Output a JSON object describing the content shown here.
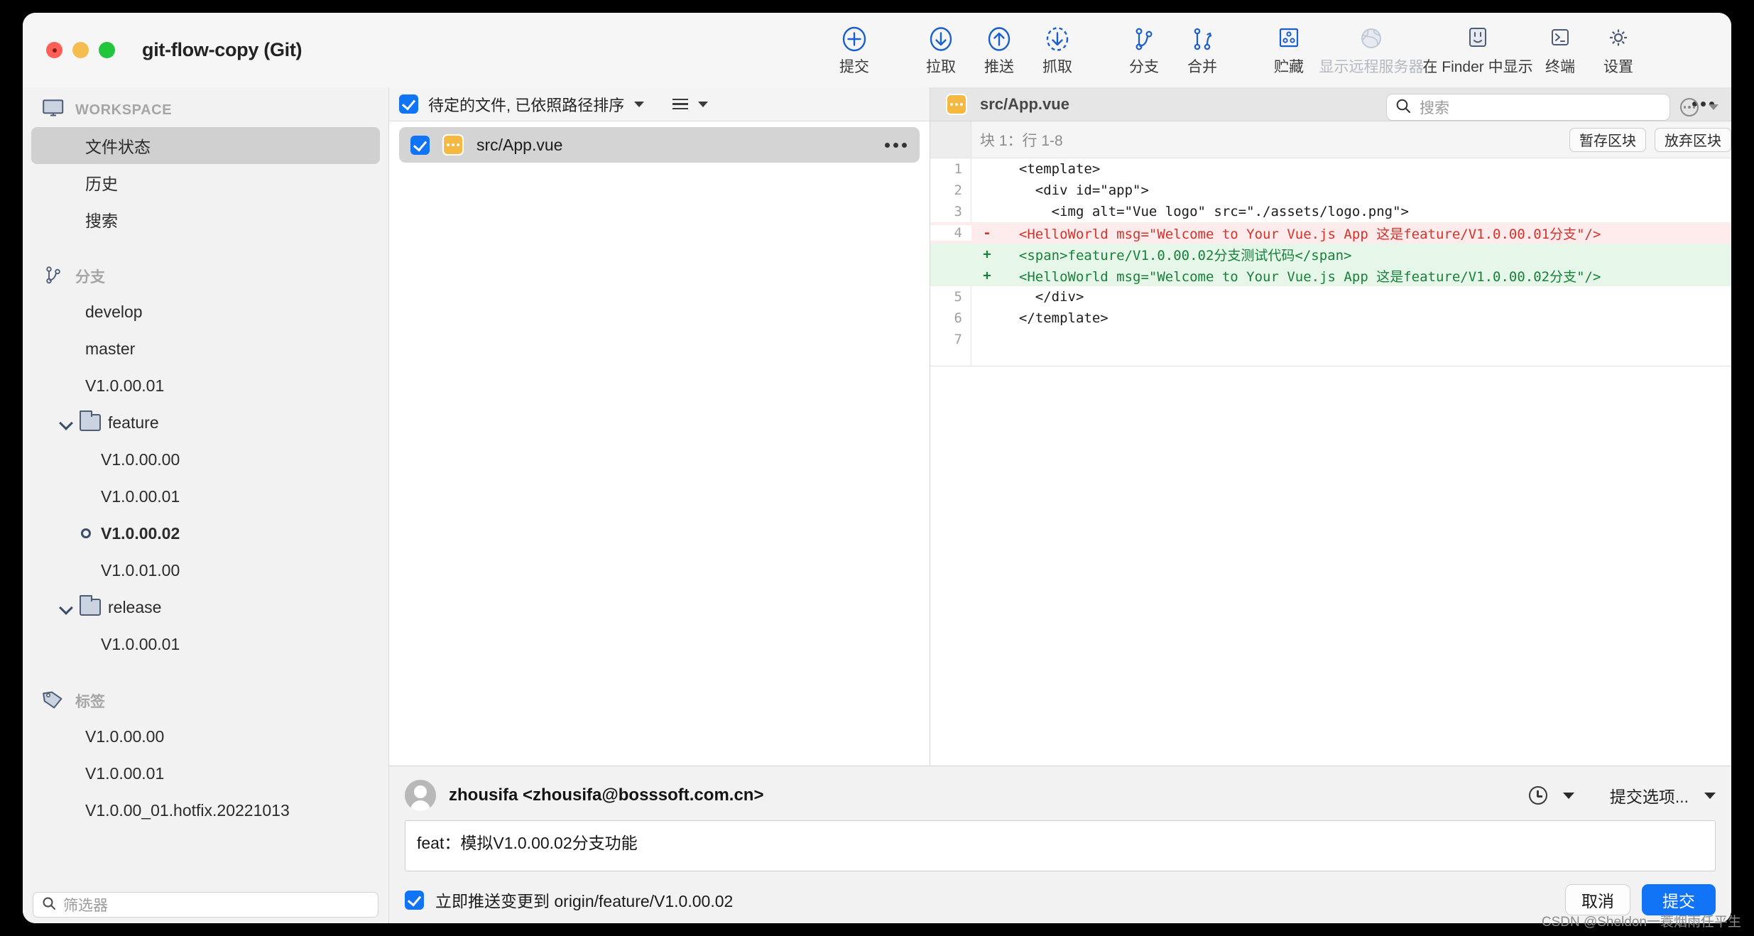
{
  "window": {
    "title": "git-flow-copy (Git)"
  },
  "toolbar": {
    "items": [
      {
        "label": "提交",
        "icon": "plus-circle-icon",
        "disabled": false
      },
      {
        "label": "拉取",
        "icon": "arrow-down-circle-icon",
        "disabled": false
      },
      {
        "label": "推送",
        "icon": "arrow-up-circle-icon",
        "disabled": false
      },
      {
        "label": "抓取",
        "icon": "arrow-down-dashed-circle-icon",
        "disabled": false
      },
      {
        "label": "分支",
        "icon": "branch-icon",
        "disabled": false
      },
      {
        "label": "合并",
        "icon": "merge-icon",
        "disabled": false
      },
      {
        "label": "贮藏",
        "icon": "stash-icon",
        "disabled": false
      },
      {
        "label": "显示远程服务器",
        "icon": "globe-icon",
        "disabled": true
      },
      {
        "label": "在 Finder 中显示",
        "icon": "finder-icon",
        "disabled": false
      },
      {
        "label": "终端",
        "icon": "terminal-icon",
        "disabled": false
      },
      {
        "label": "设置",
        "icon": "gear-icon",
        "disabled": false
      }
    ]
  },
  "sidebar": {
    "workspace": {
      "header": "WORKSPACE",
      "items": [
        {
          "label": "文件状态",
          "selected": true
        },
        {
          "label": "历史",
          "selected": false
        },
        {
          "label": "搜索",
          "selected": false
        }
      ]
    },
    "branches": {
      "header": "分支",
      "items": [
        {
          "label": "develop",
          "type": "branch",
          "indent": 0,
          "current": false
        },
        {
          "label": "master",
          "type": "branch",
          "indent": 0,
          "current": false
        },
        {
          "label": "V1.0.00.01",
          "type": "branch",
          "indent": 0,
          "current": false
        },
        {
          "label": "feature",
          "type": "folder",
          "indent": 0,
          "expanded": true
        },
        {
          "label": "V1.0.00.00",
          "type": "branch",
          "indent": 1,
          "current": false
        },
        {
          "label": "V1.0.00.01",
          "type": "branch",
          "indent": 1,
          "current": false
        },
        {
          "label": "V1.0.00.02",
          "type": "branch",
          "indent": 1,
          "current": true
        },
        {
          "label": "V1.0.01.00",
          "type": "branch",
          "indent": 1,
          "current": false
        },
        {
          "label": "release",
          "type": "folder",
          "indent": 0,
          "expanded": true
        },
        {
          "label": "V1.0.00.01",
          "type": "branch",
          "indent": 1,
          "current": false
        }
      ]
    },
    "tags": {
      "header": "标签",
      "items": [
        {
          "label": "V1.0.00.00"
        },
        {
          "label": "V1.0.00.01"
        },
        {
          "label": "V1.0.00_01.hotfix.20221013"
        }
      ]
    },
    "filter": {
      "placeholder": "筛选器",
      "value": ""
    }
  },
  "filelist": {
    "header_label": "待定的文件, 已依照路径排序",
    "header_checked": true,
    "rows": [
      {
        "name": "src/App.vue",
        "checked": true,
        "status": "modified",
        "selected": true
      }
    ]
  },
  "search": {
    "placeholder": "搜索",
    "value": ""
  },
  "diff": {
    "filename": "src/App.vue",
    "hunk_label": "块 1：行 1-8",
    "stage_hunk_label": "暂存区块",
    "discard_hunk_label": "放弃区块",
    "lines": [
      {
        "num": "1",
        "sign": "",
        "kind": "ctx",
        "text": "  <template>"
      },
      {
        "num": "2",
        "sign": "",
        "kind": "ctx",
        "text": "    <div id=\"app\">"
      },
      {
        "num": "3",
        "sign": "",
        "kind": "ctx",
        "text": "      <img alt=\"Vue logo\" src=\"./assets/logo.png\">"
      },
      {
        "num": "4",
        "sign": "-",
        "kind": "del",
        "text": "  <HelloWorld msg=\"Welcome to Your Vue.js App 这是feature/V1.0.00.01分支\"/>"
      },
      {
        "num": "",
        "sign": "+",
        "kind": "add",
        "text": "  <span>feature/V1.0.00.02分支测试代码</span>"
      },
      {
        "num": "",
        "sign": "+",
        "kind": "add",
        "text": "  <HelloWorld msg=\"Welcome to Your Vue.js App 这是feature/V1.0.00.02分支\"/>"
      },
      {
        "num": "5",
        "sign": "",
        "kind": "ctx",
        "text": "    </div>"
      },
      {
        "num": "6",
        "sign": "",
        "kind": "ctx",
        "text": "  </template>"
      },
      {
        "num": "7",
        "sign": "",
        "kind": "ctx",
        "text": ""
      }
    ]
  },
  "commit": {
    "author": "zhousifa <zhousifa@bosssoft.com.cn>",
    "options_label": "提交选项...",
    "message": "feat：模拟V1.0.00.02分支功能",
    "message_placeholder": "",
    "push_label": "立即推送变更到 origin/feature/V1.0.00.02",
    "push_checked": true,
    "cancel_label": "取消",
    "commit_label": "提交"
  },
  "watermark": "CSDN @Sheldon一蓑烟雨任平生",
  "colors": {
    "accent": "#1173f5",
    "added": "#18803a",
    "deleted": "#d0342c",
    "added_bg": "#e6f7e9",
    "deleted_bg": "#fdeceb",
    "modified_badge": "#f5b841"
  }
}
